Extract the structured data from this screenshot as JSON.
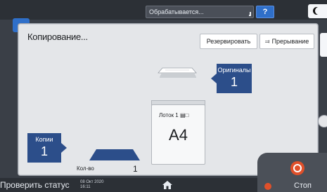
{
  "topbar": {
    "status": "Обрабатывается...",
    "help": "?"
  },
  "dialog": {
    "title": "Копирование...",
    "reserve_button": "Резервировать",
    "interrupt_button": "Прерывание"
  },
  "originals": {
    "label": "Оригиналы",
    "count": "1"
  },
  "tray": {
    "label": "Лоток 1",
    "paper_size": "A4"
  },
  "copies": {
    "label": "Копии",
    "count": "1"
  },
  "quantity": {
    "label": "Кол-во",
    "value": "1"
  },
  "bottombar": {
    "check_status": "Проверить статус",
    "date": "08 Окт 2020",
    "time": "16:11"
  },
  "stop": {
    "label": "Стоп"
  },
  "colors": {
    "accent": "#2c4e8a",
    "stop": "#e0502a",
    "help": "#2f6fc9"
  }
}
